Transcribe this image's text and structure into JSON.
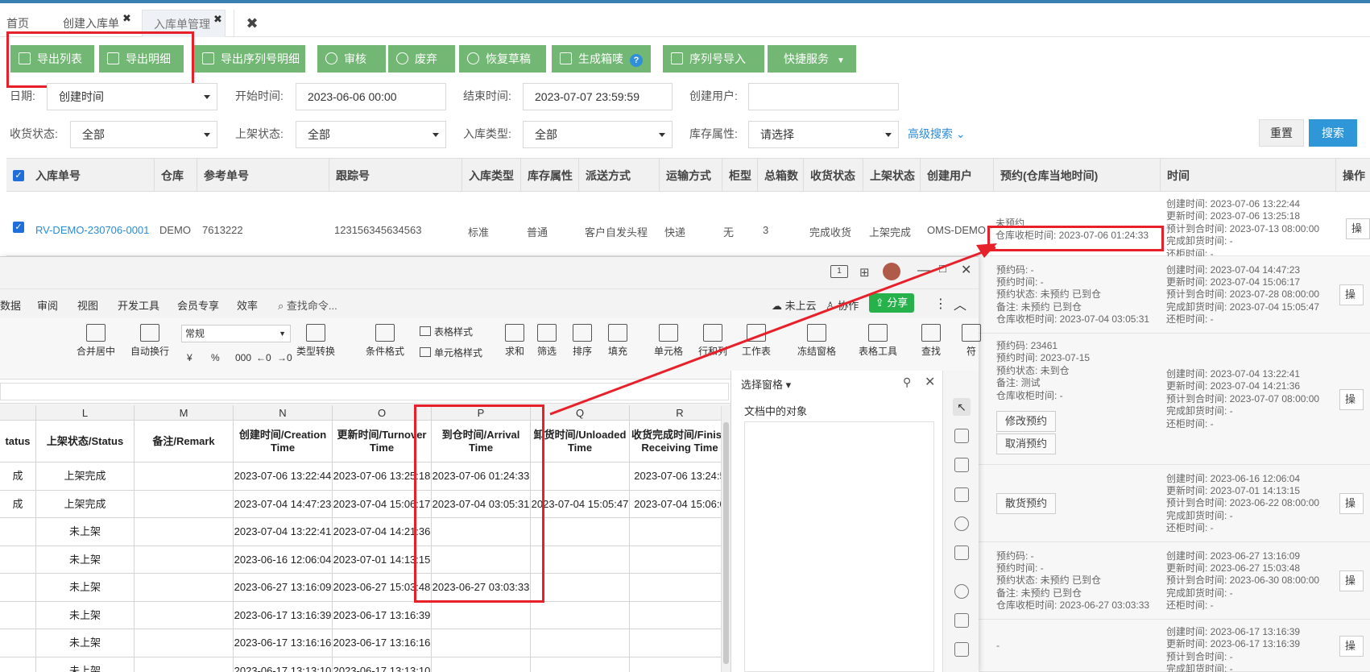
{
  "tabs": [
    {
      "label": "首页"
    },
    {
      "label": "创建入库单",
      "close": "✖"
    },
    {
      "label": "入库单管理",
      "close": "✖"
    }
  ],
  "tabs_close_all": "✖",
  "toolbar": [
    {
      "label": "导出列表",
      "icon": "export-icon"
    },
    {
      "label": "导出明细",
      "icon": "export-icon"
    },
    {
      "label": "导出序列号明细",
      "icon": "export-icon"
    },
    {
      "label": "审核",
      "icon": "user-icon"
    },
    {
      "label": "废弃",
      "icon": "ban-icon"
    },
    {
      "label": "恢复草稿",
      "icon": "ban-icon"
    },
    {
      "label": "生成箱唛",
      "icon": "download-icon",
      "help": "?"
    },
    {
      "label": "序列号导入",
      "icon": "upload-icon"
    },
    {
      "label": "快捷服务",
      "icon": "caret-down-icon"
    }
  ],
  "filters": {
    "date_label": "日期:",
    "date_value": "创建时间",
    "start_label": "开始时间:",
    "start_value": "2023-06-06 00:00",
    "end_label": "结束时间:",
    "end_value": "2023-07-07 23:59:59",
    "creator_label": "创建用户:",
    "creator_value": "",
    "recv_label": "收货状态:",
    "recv_value": "全部",
    "shelf_label": "上架状态:",
    "shelf_value": "全部",
    "type_label": "入库类型:",
    "type_value": "全部",
    "attr_label": "库存属性:",
    "attr_value": "请选择",
    "advanced": "高级搜索 ⌄",
    "reset": "重置",
    "search": "搜索"
  },
  "table": {
    "headers": [
      "入库单号",
      "仓库",
      "参考单号",
      "跟踪号",
      "入库类型",
      "库存属性",
      "派送方式",
      "运输方式",
      "柜型",
      "总箱数",
      "收货状态",
      "上架状态",
      "创建用户",
      "预约(仓库当地时间)",
      "时间",
      "操作"
    ],
    "row1": {
      "order_no": "RV-DEMO-230706-0001",
      "warehouse": "DEMO",
      "ref_no": "7613222",
      "tracking": "123156345634563",
      "type": "标准",
      "attr": "普通",
      "delivery": "客户自发头程",
      "transport": "快递",
      "container": "无",
      "boxes": "3",
      "recv": "完成收货",
      "shelf": "上架完成",
      "creator": "OMS-DEMO",
      "booking": [
        "未预约",
        "仓库收柜时间: 2023-07-06 01:24:33"
      ],
      "times": [
        "创建时间: 2023-07-06 13:22:44",
        "更新时间: 2023-07-06 13:25:18",
        "预计到合时间: 2023-07-13 08:00:00",
        "完成卸货时间: -",
        "还柜时间: -"
      ]
    },
    "side_rows": [
      {
        "booking": [
          "预约码: -",
          "预约时间: -",
          "预约状态: 未预约 已到仓",
          "备注: 未预约 已到仓",
          "仓库收柜时间: 2023-07-04 03:05:31"
        ],
        "times": [
          "创建时间: 2023-07-04 14:47:23",
          "更新时间: 2023-07-04 15:06:17",
          "预计到合时间: 2023-07-28 08:00:00",
          "完成卸货时间: 2023-07-04 15:05:47",
          "还柜时间: -"
        ]
      },
      {
        "booking": [
          "预约码: 23461",
          "预约时间: 2023-07-15",
          "预约状态: 未到仓",
          "备注: 测试",
          "仓库收柜时间: -"
        ],
        "buttons": [
          "修改预约",
          "取消预约"
        ],
        "times": [
          "创建时间: 2023-07-04 13:22:41",
          "更新时间: 2023-07-04 14:21:36",
          "预计到合时间: 2023-07-07 08:00:00",
          "完成卸货时间: -",
          "还柜时间: -"
        ]
      },
      {
        "buttons": [
          "散货预约"
        ],
        "times": [
          "创建时间: 2023-06-16 12:06:04",
          "更新时间: 2023-07-01 14:13:15",
          "预计到合时间: 2023-06-22 08:00:00",
          "完成卸货时间: -",
          "还柜时间: -"
        ]
      },
      {
        "booking": [
          "预约码: -",
          "预约时间: -",
          "预约状态: 未预约 已到仓",
          "备注: 未预约 已到仓",
          "仓库收柜时间: 2023-06-27 03:03:33"
        ],
        "times": [
          "创建时间: 2023-06-27 13:16:09",
          "更新时间: 2023-06-27 15:03:48",
          "预计到合时间: 2023-06-30 08:00:00",
          "完成卸货时间: -",
          "还柜时间: -"
        ]
      },
      {
        "booking": [
          "-"
        ],
        "times": [
          "创建时间: 2023-06-17 13:16:39",
          "更新时间: 2023-06-17 13:16:39",
          "预计到合时间: -",
          "完成卸货时间: -"
        ]
      }
    ],
    "op_label": "操"
  },
  "excel": {
    "titlebar_right": "1",
    "menus": [
      "数据",
      "审阅",
      "视图",
      "开发工具",
      "会员专享",
      "效率"
    ],
    "search_cmd": "查找命令...",
    "cloud": "未上云",
    "collab": "协作",
    "share": "分享",
    "ribbon": [
      "合并居中",
      "自动换行",
      "类型转换",
      "条件格式",
      "表格样式",
      "单元格样式",
      "求和",
      "筛选",
      "排序",
      "填充",
      "单元格",
      "行和列",
      "工作表",
      "冻结窗格",
      "表格工具",
      "查找",
      "符"
    ],
    "format_value": "常规",
    "numfmt": [
      "¥",
      "%",
      "000",
      "←0",
      "→0"
    ],
    "pane_title": "选择窗格",
    "pane_sub": "文档中的对象",
    "columns": [
      "L",
      "M",
      "N",
      "O",
      "P",
      "Q",
      "R"
    ],
    "headers": [
      "tatus",
      "上架状态/Status",
      "备注/Remark",
      "创建时间/Creation Time",
      "更新时间/Turnover Time",
      "到仓时间/Arrival Time",
      "卸货时间/Unloaded Time",
      "收货完成时间/Finish Receiving Time"
    ],
    "rows": [
      [
        "成",
        "上架完成",
        "",
        "2023-07-06 13:22:44",
        "2023-07-06 13:25:18",
        "2023-07-06 01:24:33",
        "",
        "2023-07-06 13:24:5"
      ],
      [
        "成",
        "上架完成",
        "",
        "2023-07-04 14:47:23",
        "2023-07-04 15:06:17",
        "2023-07-04 03:05:31",
        "2023-07-04 15:05:47",
        "2023-07-04 15:06:0"
      ],
      [
        "",
        "未上架",
        "",
        "2023-07-04 13:22:41",
        "2023-07-04 14:21:36",
        "",
        "",
        ""
      ],
      [
        "",
        "未上架",
        "",
        "2023-06-16 12:06:04",
        "2023-07-01 14:13:15",
        "",
        "",
        ""
      ],
      [
        "",
        "未上架",
        "",
        "2023-06-27 13:16:09",
        "2023-06-27 15:03:48",
        "2023-06-27 03:03:33",
        "",
        ""
      ],
      [
        "",
        "未上架",
        "",
        "2023-06-17 13:16:39",
        "2023-06-17 13:16:39",
        "",
        "",
        ""
      ],
      [
        "",
        "未上架",
        "",
        "2023-06-17 13:16:16",
        "2023-06-17 13:16:16",
        "",
        "",
        ""
      ],
      [
        "",
        "未上架",
        "",
        "2023-06-17 13:13:10",
        "2023-06-17 13:13:10",
        "",
        "",
        ""
      ]
    ]
  },
  "colors": {
    "accent_green": "#72b874",
    "highlight_red": "#e8202a",
    "link_blue": "#2b8cd6"
  }
}
